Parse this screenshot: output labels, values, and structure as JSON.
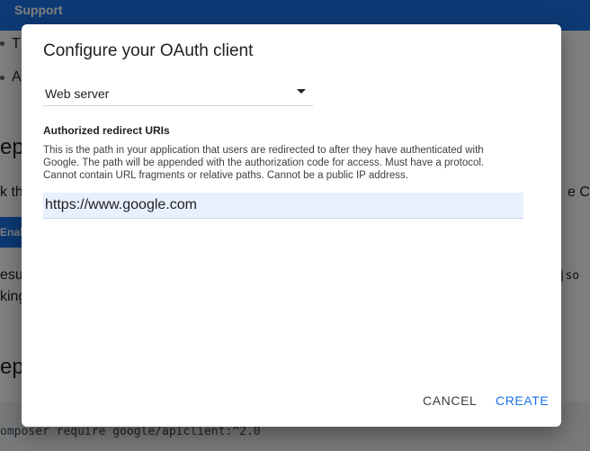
{
  "background": {
    "topbar_label": "Support",
    "bullet_1": "T",
    "bullet_2": "A",
    "heading_1": "ep",
    "line_k": "k th",
    "right_cut": "e Cal",
    "enable_button": "Enal",
    "line_esul": "esul",
    "line_king": "king",
    "right_mono": "s.jso",
    "heading_2": "ep",
    "code": "omposer require google/apiclient:^2.0"
  },
  "dialog": {
    "title": "Configure your OAuth client",
    "app_type": {
      "selected": "Web server"
    },
    "redirect_section": {
      "label": "Authorized redirect URIs",
      "helper_text": "This is the path in your application that users are redirected to after they have authenticated with Google. The path will be appended with the authorization code for access. Must have a protocol. Cannot contain URL fragments or relative paths. Cannot be a public IP address.",
      "uri_value": "https://www.google.com"
    },
    "actions": {
      "cancel_label": "CANCEL",
      "create_label": "CREATE"
    }
  },
  "colors": {
    "accent": "#1a73e8",
    "input_fill": "#e8f0fe"
  }
}
